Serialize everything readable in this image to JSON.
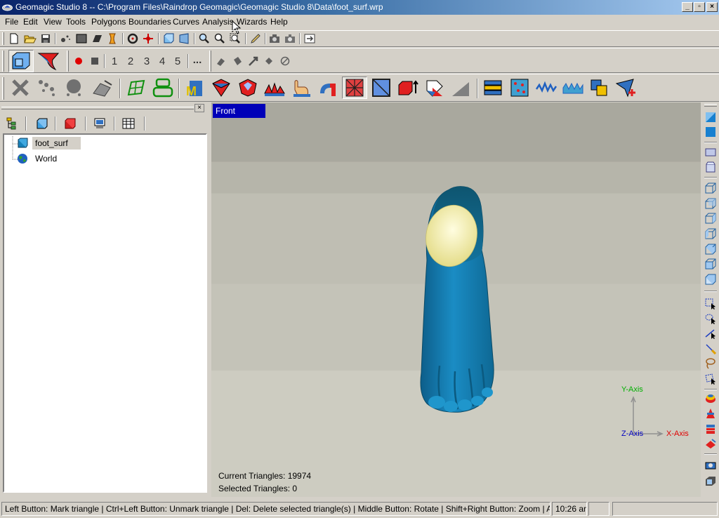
{
  "window": {
    "title": "Geomagic Studio 8 -- C:\\Program Files\\Raindrop Geomagic\\Geomagic Studio 8\\Data\\foot_surf.wrp",
    "minimize": "_",
    "maximize": "▫",
    "close": "×"
  },
  "menu": [
    {
      "label": "File"
    },
    {
      "label": "Edit"
    },
    {
      "label": "View"
    },
    {
      "label": "Tools"
    },
    {
      "label": "Polygons"
    },
    {
      "label": "Boundaries"
    },
    {
      "label": "Curves"
    },
    {
      "label": "Analysis"
    },
    {
      "label": "Wizards"
    },
    {
      "label": "Help"
    }
  ],
  "toolbar2": {
    "numbers": [
      "1",
      "2",
      "3",
      "4",
      "5"
    ],
    "more": "..."
  },
  "panel": {
    "close": "×",
    "tabs": [
      "model-manager-tab",
      "cube-tab",
      "red-cube-tab",
      "display-tab",
      "grid-tab"
    ],
    "tree": [
      {
        "label": "foot_surf",
        "icon": "mesh-object-icon",
        "selected": true
      },
      {
        "label": "World",
        "icon": "globe-icon",
        "selected": false
      }
    ]
  },
  "viewport": {
    "view_name": "Front",
    "current_triangles": "Current Triangles: 19974",
    "selected_triangles": "Selected Triangles: 0",
    "axis": {
      "y": "Y-Axis",
      "x": "X-Axis",
      "z": "Z-Axis"
    },
    "colors": {
      "mesh": "#1780b8",
      "mesh_dark": "#0e5a78",
      "selected": "#f3efb0",
      "view_label_bg": "#0000b8",
      "axis_y": "#00b000",
      "axis_x": "#e00000",
      "axis_z": "#0000c0"
    }
  },
  "status": {
    "hint": "Left Button: Mark triangle | Ctrl+Left Button: Unmark triangle | Del: Delete selected triangle(s) | Middle Button: Rotate | Shift+Right Button: Zoom | Alt+Middle Button: P",
    "time": "10:26 am"
  }
}
